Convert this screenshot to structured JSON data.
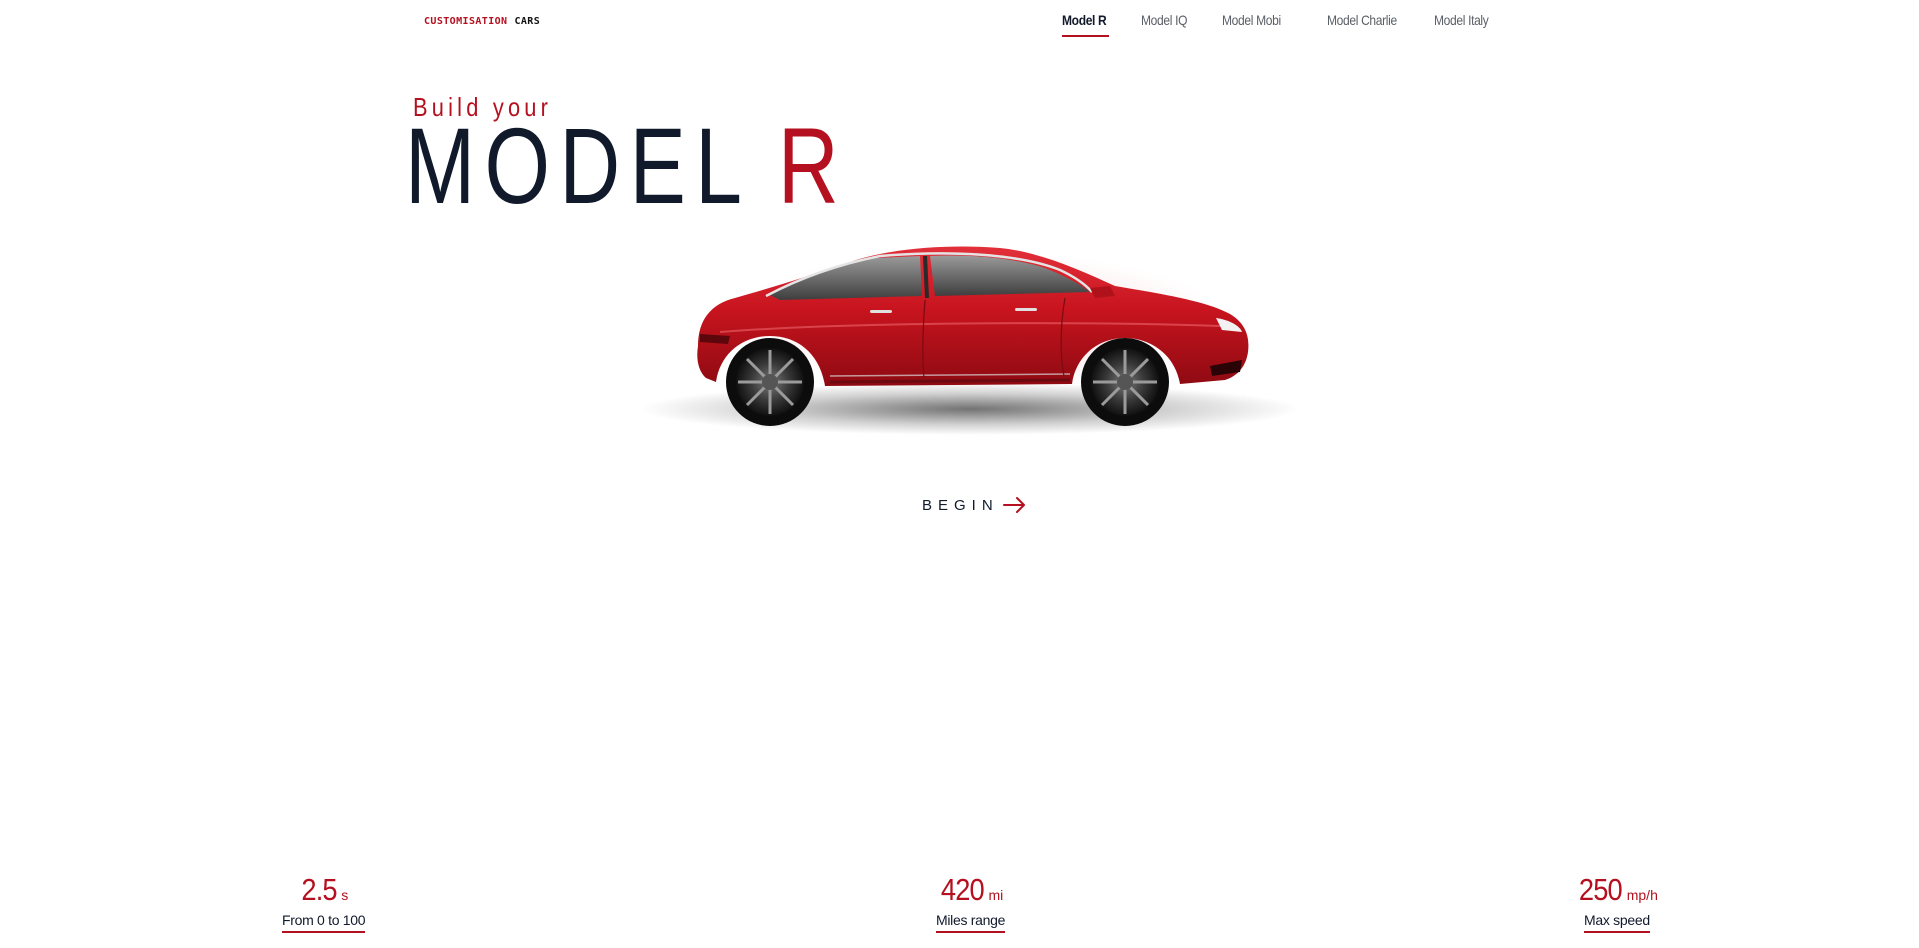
{
  "brand": {
    "part1": "CUSTOMISATION",
    "part2": "CARS"
  },
  "nav": {
    "items": [
      {
        "label": "Model R",
        "active": true
      },
      {
        "label": "Model IQ",
        "active": false
      },
      {
        "label": "Model Mobi",
        "active": false
      },
      {
        "label": "Model Charlie",
        "active": false
      },
      {
        "label": "Model Italy",
        "active": false
      }
    ]
  },
  "hero": {
    "subtitle": "Build your",
    "title_word": "MODEL",
    "title_letter": "R",
    "cta_label": "BEGIN",
    "car_color": "#c8141e"
  },
  "stats": [
    {
      "value": "2.5",
      "unit": "s",
      "label": "From 0 to 100"
    },
    {
      "value": "420",
      "unit": "mi",
      "label": "Miles range"
    },
    {
      "value": "250",
      "unit": "mp/h",
      "label": "Max speed"
    }
  ],
  "colors": {
    "accent": "#b4101f",
    "text_dark": "#111a2b",
    "nav_inactive": "#5a5f66",
    "background": "#ffffff"
  }
}
